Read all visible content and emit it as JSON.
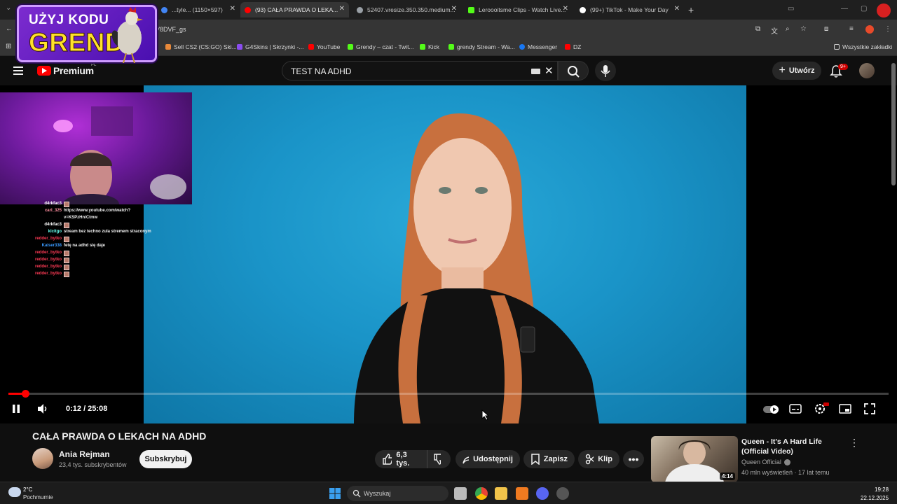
{
  "browser": {
    "tabs": [
      {
        "label": "...tyle... (1150×597)",
        "fav_color": "#4285f4"
      },
      {
        "label": "(93) CAŁA PRAWDA O LEKA...",
        "fav_color": "#ff0000"
      },
      {
        "label": "52407.vresize.350.350.medium...",
        "fav_color": "#9aa0a6"
      },
      {
        "label": "Leroooitsme Clips - Watch Live...",
        "fav_color": "#53fc18"
      },
      {
        "label": "(99+) TikTok - Make Your Day",
        "fav_color": "#ffffff"
      }
    ],
    "url": "V8DVF_gs",
    "bookmarks": [
      {
        "label": "Sell CS2 (CS:GO) Ski...",
        "color": "#e8893a"
      },
      {
        "label": "G4Skins | Skrzynki -...",
        "color": "#8a4cf0"
      },
      {
        "label": "YouTube",
        "color": "#ff0000"
      },
      {
        "label": "Grendy – czat - Twit...",
        "color": "#53fc18"
      },
      {
        "label": "Kick",
        "color": "#53fc18"
      },
      {
        "label": "grendy Stream - Wa...",
        "color": "#53fc18"
      },
      {
        "label": "Messenger",
        "color": "#1877f2"
      },
      {
        "label": "DZ",
        "color": "#ff0000"
      }
    ],
    "all_bookmarks": "Wszystkie zakładki"
  },
  "promo": {
    "line1": "UŻYJ KODU",
    "line2": "GRENDY"
  },
  "youtube": {
    "logo": "Premium",
    "region": "PL",
    "search_value": "TEST NA ADHD",
    "create_label": "Utwórz",
    "notif_count": "9+"
  },
  "player": {
    "time": "0:12 / 25:08",
    "progress": 0.008,
    "chat": [
      {
        "user": "d4rkfac3",
        "color": "#ffffff",
        "msg": "",
        "emote": true
      },
      {
        "user": "carl_325",
        "color": "#ff8fa0",
        "msg": "https://www.youtube.com/watch?",
        "emote": false
      },
      {
        "user": "",
        "color": "#ffffff",
        "msg": "v=KSPzHniCtmw",
        "emote": false
      },
      {
        "user": "d4rkfac3",
        "color": "#ffffff",
        "msg": "",
        "emote": true
      },
      {
        "user": "klcitgo",
        "color": "#66ffee",
        "msg": "stream bez techno zula stremem straconym",
        "emote": false
      },
      {
        "user": "redder_bytko",
        "color": "#ff3a55",
        "msg": "",
        "emote": true
      },
      {
        "user": "Kaiser338",
        "color": "#3a9aff",
        "msg": "fetę na adhd się daje",
        "emote": false
      },
      {
        "user": "redder_bytko",
        "color": "#ff3a55",
        "msg": "",
        "emote": true
      },
      {
        "user": "redder_bytko",
        "color": "#ff3a55",
        "msg": "",
        "emote": true
      },
      {
        "user": "redder_bytko",
        "color": "#ff3a55",
        "msg": "",
        "emote": true
      },
      {
        "user": "redder_bytko",
        "color": "#ff3a55",
        "msg": "",
        "emote": true
      }
    ]
  },
  "video": {
    "title": "CAŁA PRAWDA O LEKACH NA ADHD",
    "channel": "Ania Rejman",
    "subs": "23,4 tys. subskrybentów",
    "subscribe": "Subskrybuj",
    "likes": "6,3 tys.",
    "share": "Udostępnij",
    "save": "Zapisz",
    "clip": "Klip"
  },
  "recommendation": {
    "title": "Queen - It's A Hard Life (Official Video)",
    "channel": "Queen Official",
    "meta": "40 mln wyświetleń · 17 lat temu",
    "duration": "4:14"
  },
  "taskbar": {
    "temp": "2°C",
    "weather": "Pochmurnie",
    "search": "Wyszukaj",
    "time": "19:28",
    "date": "22.12.2025"
  }
}
